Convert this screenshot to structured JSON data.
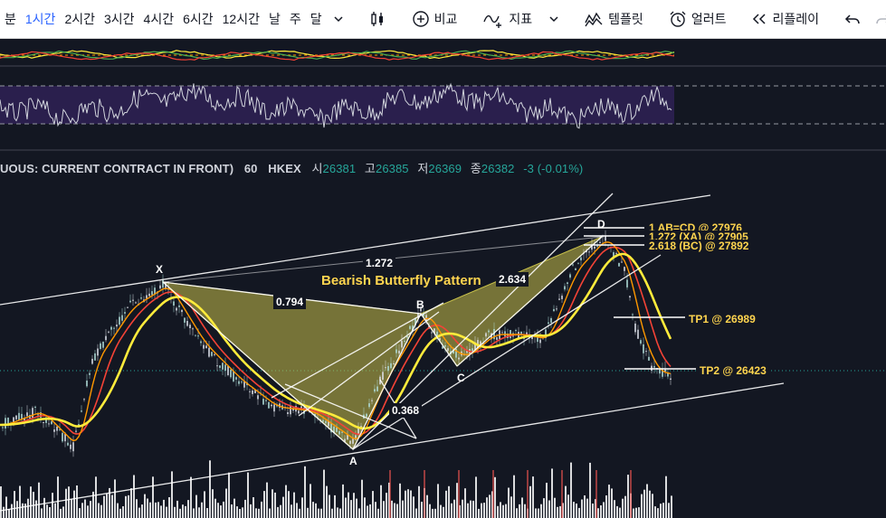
{
  "toolbar": {
    "timeframes": [
      "분",
      "1시간",
      "2시간",
      "3시간",
      "4시간",
      "6시간",
      "12시간",
      "날",
      "주",
      "달"
    ],
    "compare_label": "비교",
    "indicators_label": "지표",
    "templates_label": "템플릿",
    "alert_label": "얼러트",
    "replay_label": "리플레이"
  },
  "legend": {
    "symbol": "UOUS: CURRENT CONTRACT IN FRONT)",
    "interval": "60",
    "exchange": "HKEX",
    "open_label": "시",
    "open": "26381",
    "high_label": "고",
    "high": "26385",
    "low_label": "저",
    "low": "26369",
    "close_label": "종",
    "close": "26382",
    "change": "-3 (-0.01%)"
  },
  "pattern": {
    "name": "Bearish Butterfly Pattern",
    "points": {
      "x": "X",
      "a": "A",
      "b": "B",
      "c": "C",
      "d": "D"
    },
    "ratios": {
      "xab": "0.794",
      "abc": "0.368",
      "bcd": "2.634",
      "xa_ext": "1.272"
    }
  },
  "targets": {
    "ab_cd": "1 AB=CD @ 27976",
    "xa": "1.272 (XA) @ 27905",
    "bc": "2.618 (BC) @ 27892",
    "tp1": "TP1 @ 26989",
    "tp2": "TP2 @ 26423"
  },
  "colors": {
    "accent": "#2962ff",
    "pattern_fill": "#c8c04a",
    "ema_yellow": "#ffeb3b",
    "ema_orange": "#ff9800",
    "ema_red": "#f44336",
    "rsi_band": "#2a1f4d"
  }
}
